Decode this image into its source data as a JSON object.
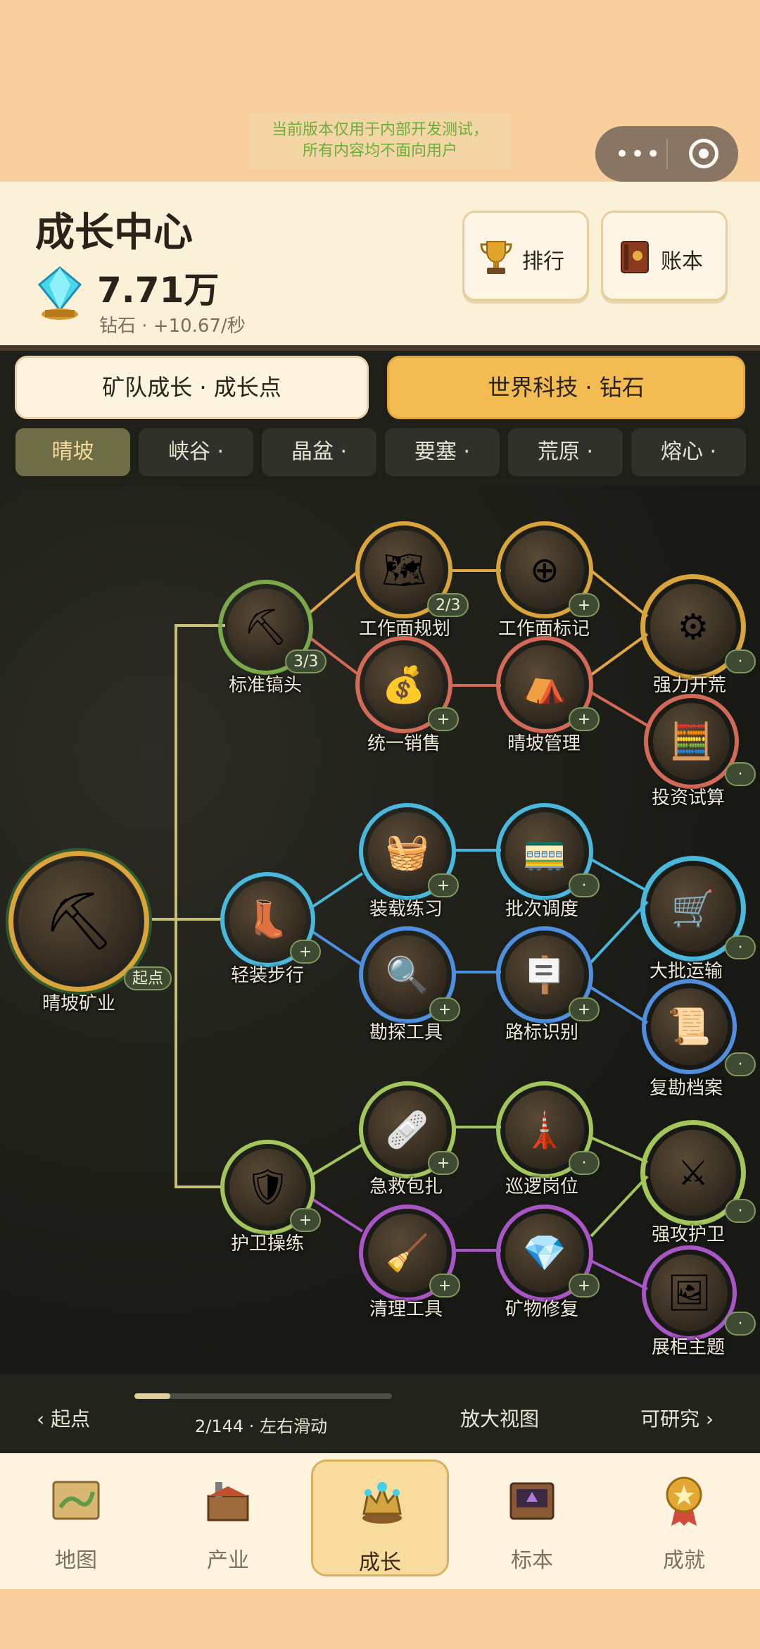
{
  "notice": {
    "line1": "当前版本仅用于内部开发测试，",
    "line2": "所有内容均不面向用户"
  },
  "header": {
    "title": "成长中心",
    "diamond_value": "7.71万",
    "diamond_sub": "钻石 · +10.67/秒",
    "buttons": [
      {
        "label": "排行",
        "icon": "trophy-icon"
      },
      {
        "label": "账本",
        "icon": "ledger-icon"
      }
    ]
  },
  "modes": [
    {
      "label": "矿队成长 · 成长点",
      "active": false
    },
    {
      "label": "世界科技 · 钻石",
      "active": true
    }
  ],
  "regions": [
    {
      "label": "晴坡",
      "active": true
    },
    {
      "label": "峡谷 ·"
    },
    {
      "label": "晶盆 ·"
    },
    {
      "label": "要塞 ·"
    },
    {
      "label": "荒原 ·"
    },
    {
      "label": "熔心 ·"
    }
  ],
  "tree": {
    "root": {
      "label": "晴坡矿业",
      "badge": "起点"
    },
    "nodes": [
      {
        "id": "n1",
        "label": "标准镐头",
        "badge": "3/3",
        "icon": "pickaxe-icon"
      },
      {
        "id": "n2",
        "label": "工作面规划",
        "badge": "2/3",
        "icon": "map-plan-icon"
      },
      {
        "id": "n3",
        "label": "工作面标记",
        "badge": "+",
        "icon": "target-icon"
      },
      {
        "id": "n4",
        "label": "强力开荒",
        "badge": "·",
        "icon": "drill-icon"
      },
      {
        "id": "n5",
        "label": "统一销售",
        "badge": "+",
        "icon": "coins-icon"
      },
      {
        "id": "n6",
        "label": "晴坡管理",
        "badge": "+",
        "icon": "camp-icon"
      },
      {
        "id": "n7",
        "label": "投资试算",
        "badge": "·",
        "icon": "calculator-icon"
      },
      {
        "id": "n8",
        "label": "轻装步行",
        "badge": "+",
        "icon": "boot-icon"
      },
      {
        "id": "n9",
        "label": "装载练习",
        "badge": "+",
        "icon": "basket-icon"
      },
      {
        "id": "n10",
        "label": "批次调度",
        "badge": "·",
        "icon": "carts-icon"
      },
      {
        "id": "n11",
        "label": "大批运输",
        "badge": "·",
        "icon": "minecart-icon"
      },
      {
        "id": "n12",
        "label": "勘探工具",
        "badge": "+",
        "icon": "magnifier-icon"
      },
      {
        "id": "n13",
        "label": "路标识别",
        "badge": "+",
        "icon": "signpost-icon"
      },
      {
        "id": "n14",
        "label": "复勘档案",
        "badge": "·",
        "icon": "archive-icon"
      },
      {
        "id": "n15",
        "label": "护卫操练",
        "badge": "+",
        "icon": "shield-icon"
      },
      {
        "id": "n16",
        "label": "急救包扎",
        "badge": "+",
        "icon": "firstaid-icon"
      },
      {
        "id": "n17",
        "label": "巡逻岗位",
        "badge": "·",
        "icon": "watchtower-icon"
      },
      {
        "id": "n18",
        "label": "强攻护卫",
        "badge": "·",
        "icon": "crossed-swords-icon"
      },
      {
        "id": "n19",
        "label": "清理工具",
        "badge": "+",
        "icon": "brush-icon"
      },
      {
        "id": "n20",
        "label": "矿物修复",
        "badge": "+",
        "icon": "crystal-icon"
      },
      {
        "id": "n21",
        "label": "展柜主题",
        "badge": "·",
        "icon": "display-case-icon"
      }
    ]
  },
  "bottom": {
    "start": "‹ 起点",
    "page": "2/144 · 左右滑动",
    "zoom": "放大视图",
    "researchable": "可研究 ›",
    "progress_fraction": 0.14
  },
  "tabs": [
    {
      "label": "地图",
      "icon": "map-icon"
    },
    {
      "label": "产业",
      "icon": "factory-icon"
    },
    {
      "label": "成长",
      "icon": "crown-icon",
      "active": true
    },
    {
      "label": "标本",
      "icon": "specimen-box-icon"
    },
    {
      "label": "成就",
      "icon": "medal-icon"
    }
  ],
  "colors": {
    "gold": "#f2bc53",
    "cream": "#fdf3df",
    "dark": "#1e1f18"
  }
}
